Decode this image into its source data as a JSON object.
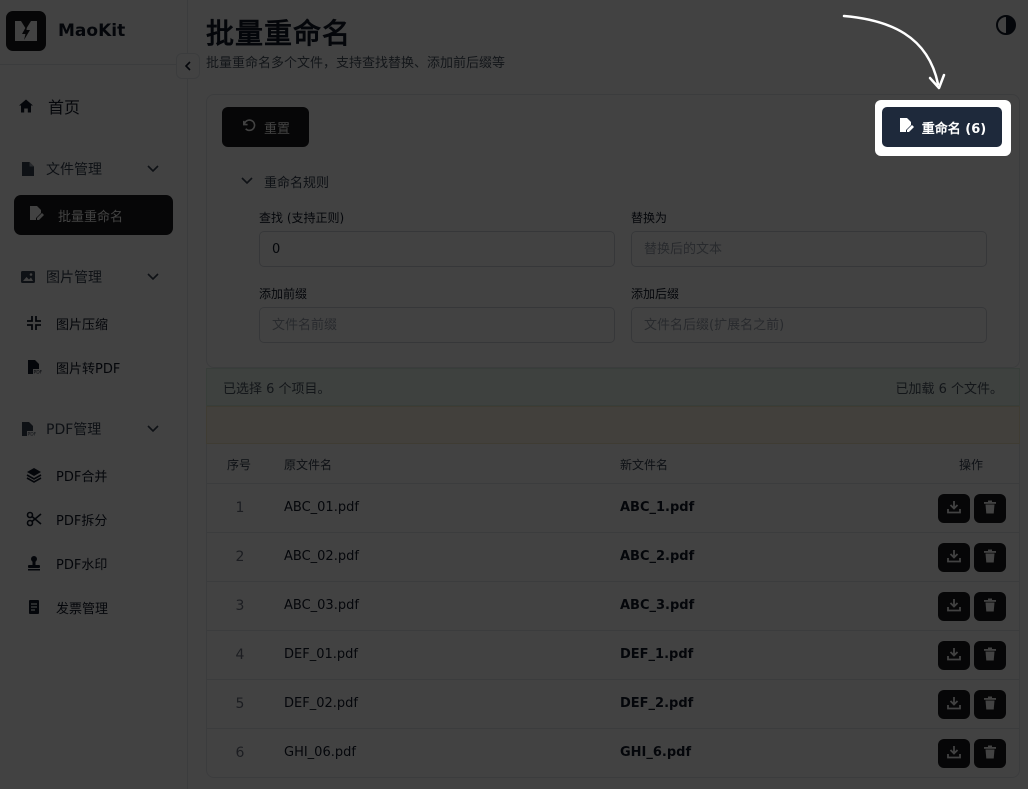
{
  "app": {
    "name": "MaoKit"
  },
  "sidebar": {
    "home": "首页",
    "groups": [
      {
        "label": "文件管理",
        "items": [
          "批量重命名"
        ]
      },
      {
        "label": "图片管理",
        "items": [
          "图片压缩",
          "图片转PDF"
        ]
      },
      {
        "label": "PDF管理",
        "items": [
          "PDF合并",
          "PDF拆分",
          "PDF水印",
          "发票管理"
        ]
      }
    ]
  },
  "page": {
    "title": "批量重命名",
    "subtitle": "批量重命名多个文件，支持查找替换、添加前后缀等"
  },
  "toolbar": {
    "reset_label": "重置",
    "rename_label": "重命名 (6)"
  },
  "rules": {
    "toggle_label": "重命名规则",
    "find_label": "查找 (支持正则)",
    "find_value": "0",
    "replace_label": "替换为",
    "replace_placeholder": "替换后的文本",
    "prefix_label": "添加前缀",
    "prefix_placeholder": "文件名前缀",
    "suffix_label": "添加后缀",
    "suffix_placeholder": "文件名后缀(扩展名之前)"
  },
  "status": {
    "selected": "已选择 6 个项目。",
    "loaded": "已加载 6 个文件。"
  },
  "table": {
    "headers": {
      "index": "序号",
      "old_name": "原文件名",
      "new_name": "新文件名",
      "actions": "操作"
    },
    "rows": [
      {
        "index": "1",
        "old_name": "ABC_01.pdf",
        "new_name": "ABC_1.pdf"
      },
      {
        "index": "2",
        "old_name": "ABC_02.pdf",
        "new_name": "ABC_2.pdf"
      },
      {
        "index": "3",
        "old_name": "ABC_03.pdf",
        "new_name": "ABC_3.pdf"
      },
      {
        "index": "4",
        "old_name": "DEF_01.pdf",
        "new_name": "DEF_1.pdf"
      },
      {
        "index": "5",
        "old_name": "DEF_02.pdf",
        "new_name": "DEF_2.pdf"
      },
      {
        "index": "6",
        "old_name": "GHI_06.pdf",
        "new_name": "GHI_6.pdf"
      }
    ]
  },
  "icons": {
    "logo": "lightning-logo-icon",
    "theme": "half-circle-theme-icon",
    "home": "home-icon",
    "file": "file-icon",
    "image": "image-icon",
    "pdf": "pdf-file-icon",
    "reset": "rotate-ccw-icon",
    "rename": "file-edit-icon",
    "download": "download-icon",
    "delete": "trash-icon"
  },
  "colors": {
    "primary": "#18181b",
    "rename_button": "#1e293b",
    "status_bg": "#eef9f1",
    "warn_bg": "#fdf7e7"
  }
}
